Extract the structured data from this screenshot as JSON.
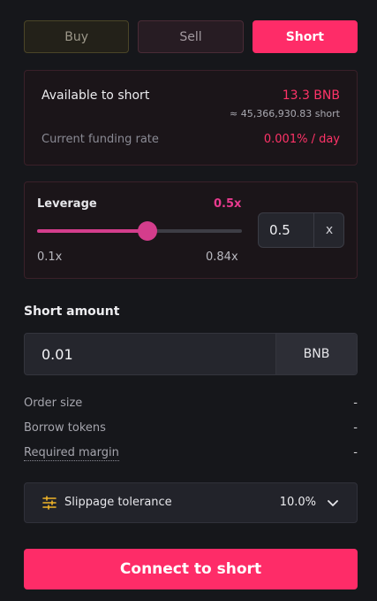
{
  "tabs": {
    "buy": "Buy",
    "sell": "Sell",
    "short": "Short",
    "active": "short"
  },
  "info": {
    "available_label": "Available to short",
    "available_value": "13.3 BNB",
    "available_sub": "≈ 45,366,930.83 short",
    "funding_label": "Current funding rate",
    "funding_value": "0.001% / day"
  },
  "leverage": {
    "label": "Leverage",
    "value_display": "0.5x",
    "min_label": "0.1x",
    "max_label": "0.84x",
    "min": 0.1,
    "max": 0.84,
    "value": 0.5,
    "input_value": "0.5",
    "unit": "x"
  },
  "amount": {
    "label": "Short amount",
    "value": "0.01",
    "unit": "BNB"
  },
  "details": [
    {
      "key": "Order size",
      "value": "-"
    },
    {
      "key": "Borrow tokens",
      "value": "-"
    },
    {
      "key": "Required margin",
      "value": "-"
    }
  ],
  "slippage": {
    "icon": "sliders-icon",
    "label": "Slippage tolerance",
    "value": "10.0%"
  },
  "cta": {
    "label": "Connect to short"
  },
  "colors": {
    "accent": "#fe2c68",
    "slider": "#d43d8c",
    "negative": "#ff3368"
  }
}
